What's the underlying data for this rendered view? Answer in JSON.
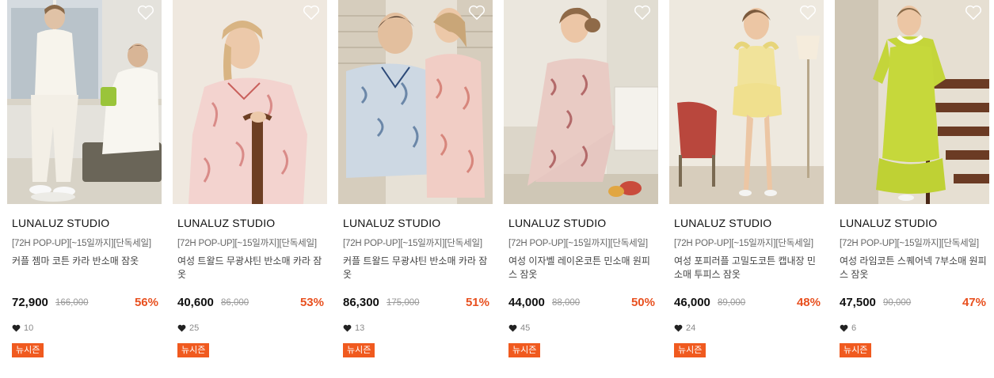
{
  "products": [
    {
      "brand": "LUNALUZ STUDIO",
      "promo": "[72H POP-UP][~15일까지][단독세일]",
      "name": "커플 젬마 코튼 카라 반소매 잠옷",
      "price": "72,900",
      "original_price": "166,000",
      "discount": "56%",
      "likes": "10",
      "badge": "뉴시즌",
      "photo": "couple-white-pajamas"
    },
    {
      "brand": "LUNALUZ STUDIO",
      "promo": "[72H POP-UP][~15일까지][단독세일]",
      "name": "여성 트왈드 무광샤틴 반소매 카라 잠옷",
      "price": "40,600",
      "original_price": "86,000",
      "discount": "53%",
      "likes": "25",
      "badge": "뉴시즌",
      "photo": "woman-pink-toile-pajamas"
    },
    {
      "brand": "LUNALUZ STUDIO",
      "promo": "[72H POP-UP][~15일까지][단독세일]",
      "name": "커플 트왈드 무광샤틴 반소매 카라 잠옷",
      "price": "86,300",
      "original_price": "175,000",
      "discount": "51%",
      "likes": "13",
      "badge": "뉴시즌",
      "photo": "couple-toile-pajamas"
    },
    {
      "brand": "LUNALUZ STUDIO",
      "promo": "[72H POP-UP][~15일까지][단독세일]",
      "name": "여성 이자벨 레이온코튼 민소매 원피스 잠옷",
      "price": "44,000",
      "original_price": "88,000",
      "discount": "50%",
      "likes": "45",
      "badge": "뉴시즌",
      "photo": "woman-floral-dress"
    },
    {
      "brand": "LUNALUZ STUDIO",
      "promo": "[72H POP-UP][~15일까지][단독세일]",
      "name": "여성 포피러플 고밀도코튼 캡내장 민소매 투피스 잠옷",
      "price": "46,000",
      "original_price": "89,000",
      "discount": "48%",
      "likes": "24",
      "badge": "뉴시즌",
      "photo": "woman-yellow-ruffle-set"
    },
    {
      "brand": "LUNALUZ STUDIO",
      "promo": "[72H POP-UP][~15일까지][단독세일]",
      "name": "여성 라임코튼 스퀘어넥 7부소매 원피스 잠옷",
      "price": "47,500",
      "original_price": "90,000",
      "discount": "47%",
      "likes": "6",
      "badge": "뉴시즌",
      "photo": "woman-lime-dress"
    }
  ],
  "icons": {
    "wishlist": "heart-outline-icon",
    "likes": "heart-filled-icon"
  },
  "colors": {
    "discount": "#e8501f",
    "badge": "#f05a1f"
  }
}
